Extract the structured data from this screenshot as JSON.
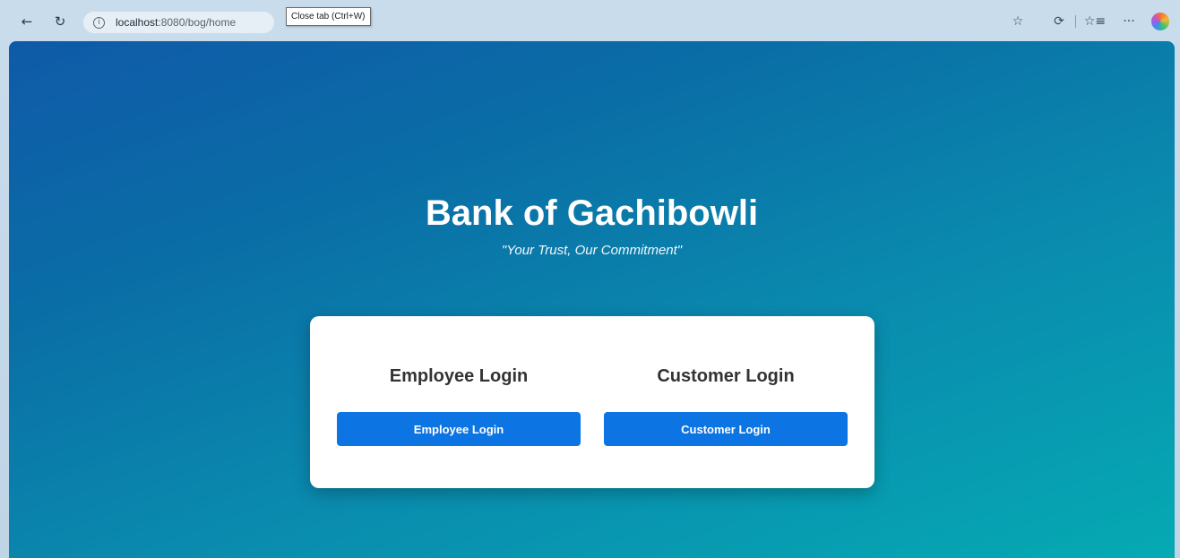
{
  "browser": {
    "url_host": "localhost",
    "url_path": ":8080/bog/home",
    "tooltip": "Close tab (Ctrl+W)"
  },
  "icons": {
    "back": "back-arrow-icon",
    "refresh": "refresh-icon",
    "info": "info-icon",
    "favorite": "star-icon",
    "extensions": "extensions-icon",
    "favorites_bar": "favorites-icon",
    "more": "more-icon",
    "copilot": "copilot-icon"
  },
  "hero": {
    "title": "Bank of Gachibowli",
    "tagline": "\"Your Trust, Our Commitment\""
  },
  "employee": {
    "heading": "Employee Login",
    "button_label": "Employee Login"
  },
  "customer": {
    "heading": "Customer Login",
    "button_label": "Customer Login"
  },
  "colors": {
    "primary_button": "#0d74e3",
    "gradient_start": "#0f5aa8",
    "gradient_end": "#05aab3"
  }
}
